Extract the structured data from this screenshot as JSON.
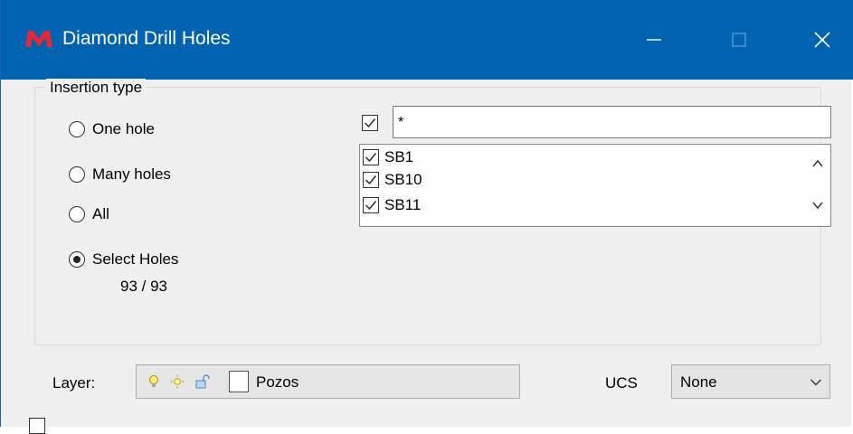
{
  "window": {
    "title": "Diamond Drill Holes",
    "accent_color": "#0063b1",
    "logo_color": "#e0293a",
    "controls": {
      "minimize": "minimize-icon",
      "maximize": "maximize-icon",
      "close": "close-icon"
    }
  },
  "insertion": {
    "group_label": "Insertion type",
    "options": [
      {
        "label": "One hole",
        "checked": false
      },
      {
        "label": "Many holes",
        "checked": false
      },
      {
        "label": "All",
        "checked": false
      },
      {
        "label": "Select Holes",
        "checked": true
      }
    ],
    "count": "93 / 93"
  },
  "filter": {
    "checked": true,
    "value": "*"
  },
  "holes": [
    {
      "label": "SB1",
      "checked": true
    },
    {
      "label": "SB10",
      "checked": true
    },
    {
      "label": "SB11",
      "checked": true
    }
  ],
  "layer": {
    "label": "Layer:",
    "name": "Pozos",
    "icons": [
      "lightbulb-icon",
      "sun-icon",
      "unlock-icon"
    ]
  },
  "ucs": {
    "label": "UCS",
    "value": "None"
  },
  "bottom": {
    "checked": false
  }
}
